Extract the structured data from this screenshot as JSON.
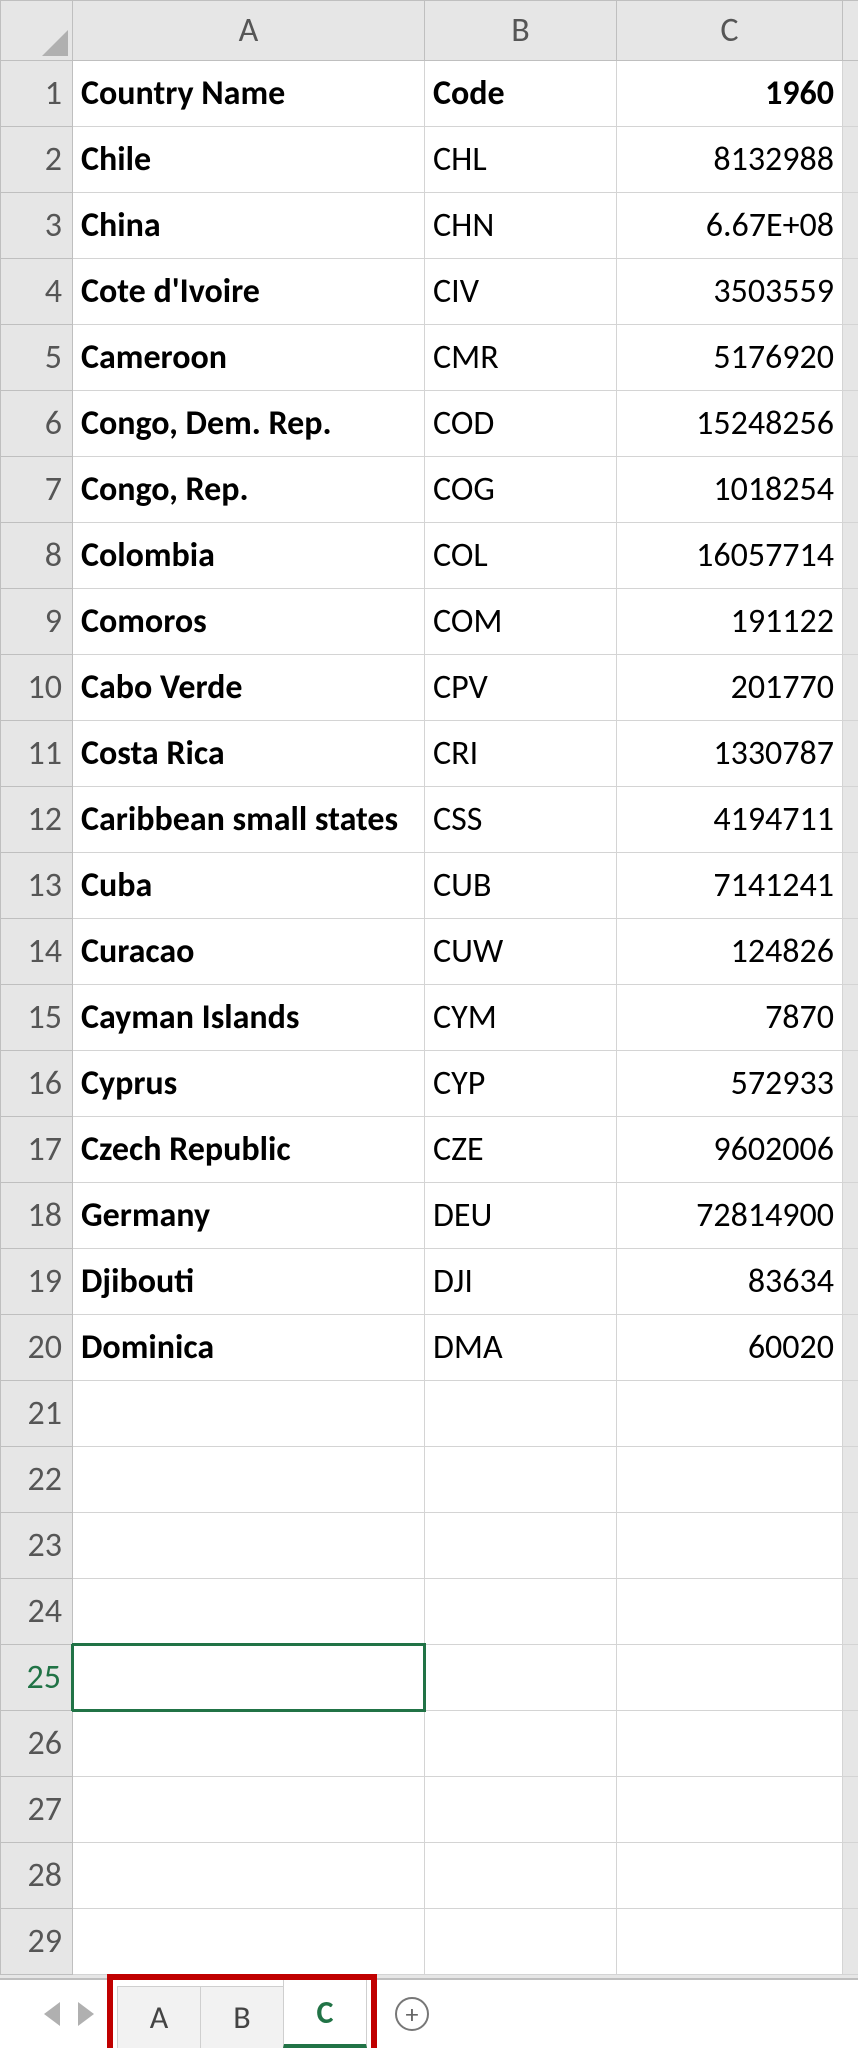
{
  "columns": [
    "A",
    "B",
    "C"
  ],
  "header_row": {
    "A": "Country Name",
    "B": "Code",
    "C": "1960"
  },
  "rows": [
    {
      "n": 1,
      "A": "Country Name",
      "B": "Code",
      "C": "1960",
      "is_header": true
    },
    {
      "n": 2,
      "A": "Chile",
      "B": "CHL",
      "C": "8132988"
    },
    {
      "n": 3,
      "A": "China",
      "B": "CHN",
      "C": "6.67E+08"
    },
    {
      "n": 4,
      "A": "Cote d'Ivoire",
      "B": "CIV",
      "C": "3503559"
    },
    {
      "n": 5,
      "A": "Cameroon",
      "B": "CMR",
      "C": "5176920"
    },
    {
      "n": 6,
      "A": "Congo, Dem. Rep.",
      "B": "COD",
      "C": "15248256"
    },
    {
      "n": 7,
      "A": "Congo, Rep.",
      "B": "COG",
      "C": "1018254"
    },
    {
      "n": 8,
      "A": "Colombia",
      "B": "COL",
      "C": "16057714"
    },
    {
      "n": 9,
      "A": "Comoros",
      "B": "COM",
      "C": "191122"
    },
    {
      "n": 10,
      "A": "Cabo Verde",
      "B": "CPV",
      "C": "201770"
    },
    {
      "n": 11,
      "A": "Costa Rica",
      "B": "CRI",
      "C": "1330787"
    },
    {
      "n": 12,
      "A": "Caribbean small states",
      "B": "CSS",
      "C": "4194711"
    },
    {
      "n": 13,
      "A": "Cuba",
      "B": "CUB",
      "C": "7141241"
    },
    {
      "n": 14,
      "A": "Curacao",
      "B": "CUW",
      "C": "124826"
    },
    {
      "n": 15,
      "A": "Cayman Islands",
      "B": "CYM",
      "C": "7870"
    },
    {
      "n": 16,
      "A": "Cyprus",
      "B": "CYP",
      "C": "572933"
    },
    {
      "n": 17,
      "A": "Czech Republic",
      "B": "CZE",
      "C": "9602006"
    },
    {
      "n": 18,
      "A": "Germany",
      "B": "DEU",
      "C": "72814900"
    },
    {
      "n": 19,
      "A": "Djibouti",
      "B": "DJI",
      "C": "83634"
    },
    {
      "n": 20,
      "A": "Dominica",
      "B": "DMA",
      "C": "60020"
    },
    {
      "n": 21,
      "A": "",
      "B": "",
      "C": ""
    },
    {
      "n": 22,
      "A": "",
      "B": "",
      "C": ""
    },
    {
      "n": 23,
      "A": "",
      "B": "",
      "C": ""
    },
    {
      "n": 24,
      "A": "",
      "B": "",
      "C": ""
    },
    {
      "n": 25,
      "A": "",
      "B": "",
      "C": "",
      "active": true
    },
    {
      "n": 26,
      "A": "",
      "B": "",
      "C": ""
    },
    {
      "n": 27,
      "A": "",
      "B": "",
      "C": ""
    },
    {
      "n": 28,
      "A": "",
      "B": "",
      "C": ""
    },
    {
      "n": 29,
      "A": "",
      "B": "",
      "C": ""
    }
  ],
  "sheet_tabs": [
    {
      "label": "A",
      "active": false
    },
    {
      "label": "B",
      "active": false
    },
    {
      "label": "C",
      "active": true
    }
  ],
  "add_tab_glyph": "+",
  "active_cell": "A25",
  "colors": {
    "accent": "#217346",
    "highlight": "#c00000"
  }
}
